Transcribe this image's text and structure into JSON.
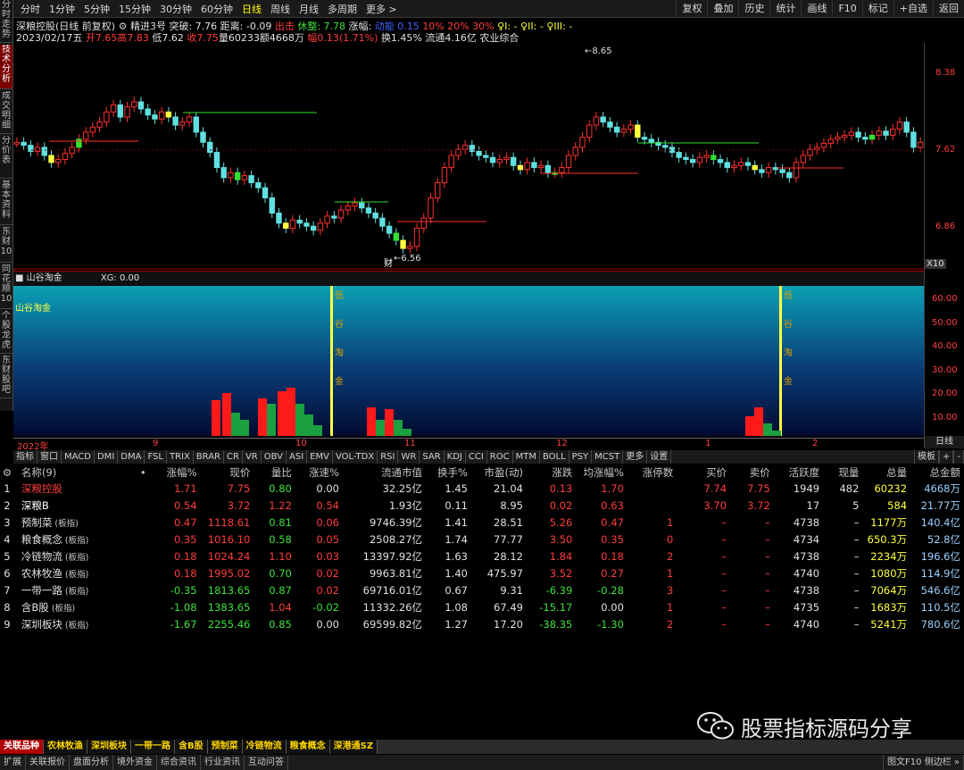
{
  "periods": [
    "分时",
    "1分钟",
    "5分钟",
    "15分钟",
    "30分钟",
    "60分钟",
    "日线",
    "周线",
    "月线",
    "多周期",
    "更多 >"
  ],
  "active_period": "日线",
  "right_tools": [
    "复权",
    "叠加",
    "历史",
    "统计",
    "画线",
    "F10",
    "标记",
    "+自选",
    "返回"
  ],
  "left_tabs": [
    "分时走势",
    "技术分析",
    "成交明细",
    "分价表",
    "基本资料",
    "东财10",
    "同花顺10",
    "个股龙虎",
    "东财股吧"
  ],
  "info1": {
    "title": "深粮控股(日线 前复权)",
    "b1": "精进3号",
    "b2": "突破: 7.76",
    "b3": "距离: -0.09",
    "r1": "出击",
    "g1": "休整: 7.78",
    "w1": "涨幅:",
    "c1": "动能",
    "c2": "0.15",
    "m1": "10%",
    "m2": "20%",
    "m3": "30%",
    "s1": "♀I: -",
    "s2": "♀II: -",
    "s3": "♀III: -"
  },
  "info2": {
    "date": "2023/02/17五",
    "open": "开7.65",
    "high": "高7.83",
    "low": "低7.62",
    "close": "收7.75",
    "vol": "量60233",
    "amt": "额4668万",
    "amp": "幅0.13(1.71%)",
    "turn": "换1.45%",
    "float": "流通4.16亿",
    "industry": "农业综合"
  },
  "price_labels": {
    "high": "8.65",
    "low": "6.56",
    "cai": "财"
  },
  "yaxis": [
    "8.38",
    "7.62",
    "6.86"
  ],
  "ind_head": {
    "name": "山谷淘金",
    "xg": "XG: 0.00"
  },
  "ind_label": "山谷淘金",
  "ind_signal": [
    "低",
    "谷",
    "淘",
    "金"
  ],
  "ind_yaxis": [
    "60.00",
    "50.00",
    "40.00",
    "30.00",
    "20.00",
    "10.00"
  ],
  "x10": "X10",
  "date_axis": [
    "2022年",
    "9",
    "10",
    "11",
    "12",
    "1",
    "2"
  ],
  "daily": "日线",
  "ind_tabs": [
    "指标",
    "窗口",
    "MACD",
    "DMI",
    "DMA",
    "FSL",
    "TRIX",
    "BRAR",
    "CR",
    "VR",
    "OBV",
    "ASI",
    "EMV",
    "VOL-TDX",
    "RSI",
    "WR",
    "SAR",
    "KDJ",
    "CCI",
    "ROC",
    "MTM",
    "BOLL",
    "PSY",
    "MCST",
    "更多",
    "设置"
  ],
  "ind_tabs_right": [
    "模板",
    "+",
    "-"
  ],
  "table_headers": [
    "",
    "名称(9)",
    "•",
    "涨幅%",
    "现价",
    "量比",
    "涨速%",
    "流通市值",
    "换手%",
    "市盈(动)",
    "涨跌",
    "均涨幅%",
    "涨停数",
    "买价",
    "卖价",
    "活跃度",
    "现量",
    "总量",
    "总金额"
  ],
  "rows": [
    {
      "n": "1",
      "name": "深粮控股",
      "tag": "",
      "chg": "1.71",
      "price": "7.75",
      "lb": "0.80",
      "zs": "0.00",
      "mv": "32.25亿",
      "hs": "1.45",
      "pe": "21.04",
      "zd": "0.13",
      "avg": "1.70",
      "zt": "",
      "buy": "7.74",
      "sell": "7.75",
      "act": "1949",
      "xl": "482",
      "vol": "60232",
      "amt": "4668万"
    },
    {
      "n": "2",
      "name": "深粮B",
      "tag": "",
      "chg": "0.54",
      "price": "3.72",
      "lb": "1.22",
      "zs": "0.54",
      "mv": "1.93亿",
      "hs": "0.11",
      "pe": "8.95",
      "zd": "0.02",
      "avg": "0.63",
      "zt": "",
      "buy": "3.70",
      "sell": "3.72",
      "act": "17",
      "xl": "5",
      "vol": "584",
      "amt": "21.77万"
    },
    {
      "n": "3",
      "name": "预制菜",
      "tag": "(板指)",
      "chg": "0.47",
      "price": "1118.61",
      "lb": "0.81",
      "zs": "0.06",
      "mv": "9746.39亿",
      "hs": "1.41",
      "pe": "28.51",
      "zd": "5.26",
      "avg": "0.47",
      "zt": "1",
      "buy": "–",
      "sell": "–",
      "act": "4738",
      "xl": "–",
      "vol": "1177万",
      "amt": "140.4亿"
    },
    {
      "n": "4",
      "name": "粮食概念",
      "tag": "(板指)",
      "chg": "0.35",
      "price": "1016.10",
      "lb": "0.58",
      "zs": "0.05",
      "mv": "2508.27亿",
      "hs": "1.74",
      "pe": "77.77",
      "zd": "3.50",
      "avg": "0.35",
      "zt": "0",
      "buy": "–",
      "sell": "–",
      "act": "4734",
      "xl": "–",
      "vol": "650.3万",
      "amt": "52.8亿"
    },
    {
      "n": "5",
      "name": "冷链物流",
      "tag": "(板指)",
      "chg": "0.18",
      "price": "1024.24",
      "lb": "1.10",
      "zs": "0.03",
      "mv": "13397.92亿",
      "hs": "1.63",
      "pe": "28.12",
      "zd": "1.84",
      "avg": "0.18",
      "zt": "2",
      "buy": "–",
      "sell": "–",
      "act": "4738",
      "xl": "–",
      "vol": "2234万",
      "amt": "196.6亿"
    },
    {
      "n": "6",
      "name": "农林牧渔",
      "tag": "(板指)",
      "chg": "0.18",
      "price": "1995.02",
      "lb": "0.70",
      "zs": "0.02",
      "mv": "9963.81亿",
      "hs": "1.40",
      "pe": "475.97",
      "zd": "3.52",
      "avg": "0.27",
      "zt": "1",
      "buy": "–",
      "sell": "–",
      "act": "4740",
      "xl": "–",
      "vol": "1080万",
      "amt": "114.9亿"
    },
    {
      "n": "7",
      "name": "一带一路",
      "tag": "(板指)",
      "chg": "-0.35",
      "price": "1813.65",
      "lb": "0.87",
      "zs": "0.02",
      "mv": "69716.01亿",
      "hs": "0.67",
      "pe": "9.31",
      "zd": "-6.39",
      "avg": "-0.28",
      "zt": "3",
      "buy": "–",
      "sell": "–",
      "act": "4738",
      "xl": "–",
      "vol": "7064万",
      "amt": "546.6亿"
    },
    {
      "n": "8",
      "name": "含B股",
      "tag": "(板指)",
      "chg": "-1.08",
      "price": "1383.65",
      "lb": "1.04",
      "zs": "-0.02",
      "mv": "11332.26亿",
      "hs": "1.08",
      "pe": "67.49",
      "zd": "-15.17",
      "avg": "0.00",
      "zt": "1",
      "buy": "–",
      "sell": "–",
      "act": "4735",
      "xl": "–",
      "vol": "1683万",
      "amt": "110.5亿"
    },
    {
      "n": "9",
      "name": "深圳板块",
      "tag": "(板指)",
      "chg": "-1.67",
      "price": "2255.46",
      "lb": "0.85",
      "zs": "0.00",
      "mv": "69599.82亿",
      "hs": "1.27",
      "pe": "17.20",
      "zd": "-38.35",
      "avg": "-1.30",
      "zt": "2",
      "buy": "–",
      "sell": "–",
      "act": "4740",
      "xl": "–",
      "vol": "5241万",
      "amt": "780.6亿"
    }
  ],
  "bottom_tabs": [
    "关联品种",
    "农林牧渔",
    "深圳板块",
    "一带一路",
    "含B股",
    "预制菜",
    "冷链物流",
    "粮食概念",
    "深港通SZ"
  ],
  "status": [
    "扩展",
    "关联报价",
    "盘面分析",
    "境外资金",
    "综合资讯",
    "行业资讯",
    "互动问答"
  ],
  "status_right": "图文F10 侧边栏 »",
  "watermark": "股票指标源码分享",
  "colors": {
    "up": "#ff3c3c",
    "down": "#3ce03c",
    "signal": "#ffff40",
    "candle_down": "#60e0e0"
  }
}
